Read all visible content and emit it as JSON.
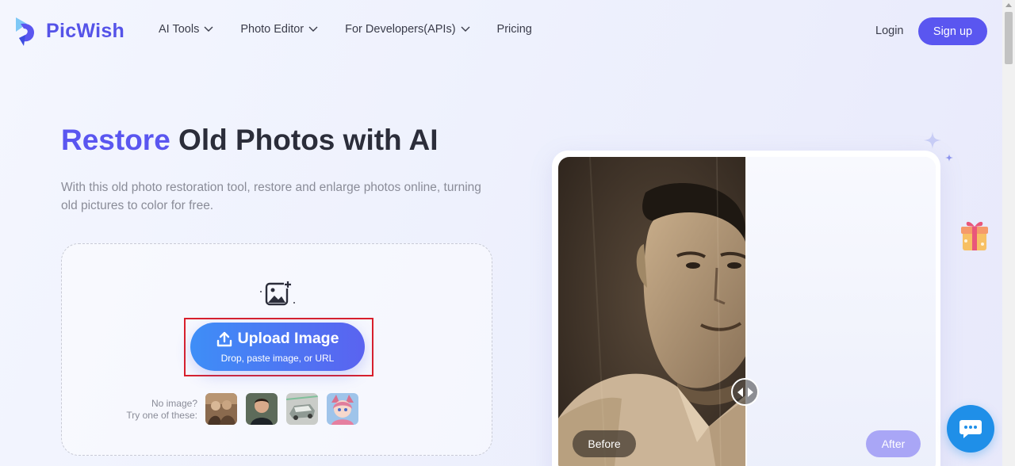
{
  "brand": {
    "name": "PicWish",
    "color": "#5553e8"
  },
  "nav": {
    "items": [
      {
        "label": "AI Tools",
        "has_dropdown": true
      },
      {
        "label": "Photo Editor",
        "has_dropdown": true
      },
      {
        "label": "For Developers(APIs)",
        "has_dropdown": true
      },
      {
        "label": "Pricing",
        "has_dropdown": false
      }
    ],
    "login_label": "Login",
    "signup_label": "Sign up"
  },
  "hero": {
    "title_accent": "Restore",
    "title_rest": " Old Photos with AI",
    "subtitle": "With this old photo restoration tool, restore and enlarge photos online, turning old pictures to color for free."
  },
  "upload": {
    "button_label": "Upload Image",
    "button_sublabel": "Drop, paste image, or URL",
    "try_line1": "No image?",
    "try_line2": "Try one of these:",
    "samples": [
      {
        "name": "sample-sepia-group-photo"
      },
      {
        "name": "sample-portrait-boy"
      },
      {
        "name": "sample-damaged-car-photo"
      },
      {
        "name": "sample-anime-girl"
      }
    ]
  },
  "compare": {
    "before_label": "Before",
    "after_label": "After"
  },
  "colors": {
    "accent": "#5a56f0",
    "upload_gradient_start": "#3e8ef7",
    "highlight_border": "#d9202c",
    "chat_button": "#1f8fe8"
  },
  "icons": [
    "picwish-logo-icon",
    "chevron-down-icon",
    "add-image-icon",
    "upload-arrow-icon",
    "sparkle-icon",
    "gift-icon",
    "chat-icon",
    "compare-handle-icon"
  ]
}
